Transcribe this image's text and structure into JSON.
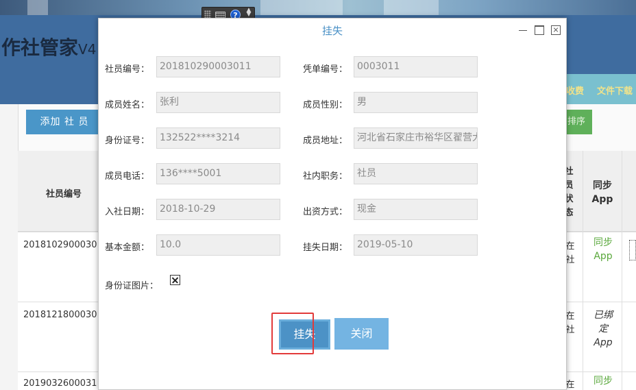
{
  "app": {
    "title": "作社管家",
    "version": "V4"
  },
  "nav_tabs": [
    {
      "label": "收费"
    },
    {
      "label": "文件下载"
    }
  ],
  "toolbar_bg": {
    "add_label": "添加 社 员",
    "sort_label": "排序"
  },
  "table": {
    "col_member_id": "社员编号",
    "col_status": [
      "社",
      "员",
      "状",
      "态"
    ],
    "col_sync": [
      "同步",
      "App"
    ],
    "rows": [
      {
        "id": "2018102900030",
        "status": [
          "在",
          "社"
        ],
        "sync": [
          "同步",
          "App"
        ]
      },
      {
        "id": "2018121800030",
        "status": [
          "在",
          "社"
        ],
        "sync": [
          "已绑",
          "定",
          "App"
        ]
      },
      {
        "id": "2019032600031",
        "status": [
          "在"
        ],
        "sync": [
          "同步"
        ]
      }
    ]
  },
  "floating_toolbar": {
    "help_glyph": "?"
  },
  "dialog": {
    "title": "挂失",
    "fields": {
      "member_id": {
        "label": "社员编号：",
        "value": "201810290003011"
      },
      "voucher_id": {
        "label": "凭单编号：",
        "value": "0003011"
      },
      "name": {
        "label": "成员姓名：",
        "value": "张利"
      },
      "gender": {
        "label": "成员性别：",
        "value": "男"
      },
      "id_number": {
        "label": "身份证号：",
        "value": "132522****3214"
      },
      "address": {
        "label": "成员地址：",
        "value": "河北省石家庄市裕华区翟营大街"
      },
      "phone": {
        "label": "成员电话：",
        "value": "136****5001"
      },
      "position": {
        "label": "社内职务：",
        "value": "社员"
      },
      "join_date": {
        "label": "入社日期：",
        "value": "2018-10-29"
      },
      "payment": {
        "label": "出资方式：",
        "value": "现金"
      },
      "amount": {
        "label": "基本金额：",
        "value": "10.0"
      },
      "loss_date": {
        "label": "挂失日期：",
        "value": "2019-05-10"
      }
    },
    "id_photo_label": "身份证图片：",
    "report_loss_button": "挂失",
    "close_button": "关闭"
  }
}
